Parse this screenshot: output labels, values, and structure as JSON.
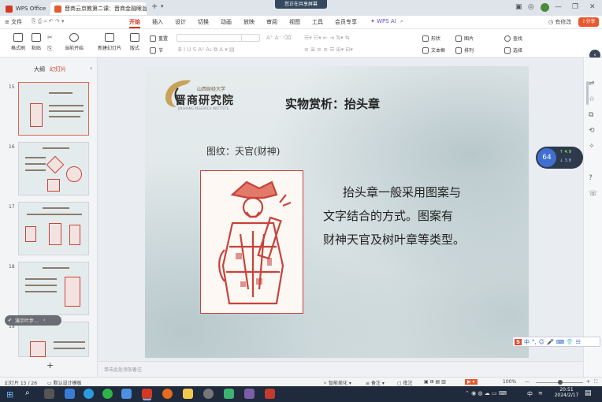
{
  "titlebar": {
    "home_tab": "WPS Office",
    "doc_tab": "晋商云京教第二课：晋商金融眼旨",
    "share_notice": "您正在共享屏幕"
  },
  "menubar": {
    "file": "文件",
    "items": [
      "开始",
      "插入",
      "设计",
      "切换",
      "动画",
      "放映",
      "审阅",
      "视图",
      "工具",
      "会员专享"
    ],
    "active": "开始",
    "ai": "WPS AI",
    "edit_mode": "有修改",
    "share": "分享"
  },
  "toolbar": {
    "format_painter": "格式刷",
    "paste": "粘贴",
    "from_current": "当前开始",
    "new_slide": "新建幻灯片",
    "layout": "版式",
    "section": "节",
    "reset": "重置",
    "shape": "形状",
    "picture": "图片",
    "find": "查找",
    "textbox": "文本框",
    "arrange": "排列",
    "select": "选择"
  },
  "leftpanel": {
    "tab_outline": "大纲",
    "tab_slides": "幻灯片",
    "thumbs": [
      {
        "num": "15"
      },
      {
        "num": "16"
      },
      {
        "num": "17"
      },
      {
        "num": "18"
      },
      {
        "num": "19"
      }
    ],
    "toast": "演示叶步…"
  },
  "slide": {
    "logo_top": "山西财经大学",
    "logo_name": "晋商研究院",
    "logo_sub": "JINSHANG RESEARCH INSTITUTE",
    "title": "实物赏析：抬头章",
    "pattern_label": "图纹：天官(财神)",
    "body_lines": [
      "抬头章一般采用图案与",
      "文字结合的方式。图案有",
      "财神天官及树叶章等类型。"
    ]
  },
  "notes_placeholder": "单击此处添加备注",
  "net_widget": {
    "percent": "64",
    "up": "4.9",
    "down": "3.8"
  },
  "statusbar": {
    "slide_counter": "幻灯片 15 / 26",
    "design_template": "默认设计模板",
    "beautify": "智能美化",
    "notes": "备注",
    "comment": "批注",
    "zoom": "100%"
  },
  "taskbar": {
    "time": "20:51",
    "date": "2024/2/17",
    "lang": "中"
  },
  "colors": {
    "accent": "#d0341d",
    "stamp_red": "#c8423a"
  }
}
